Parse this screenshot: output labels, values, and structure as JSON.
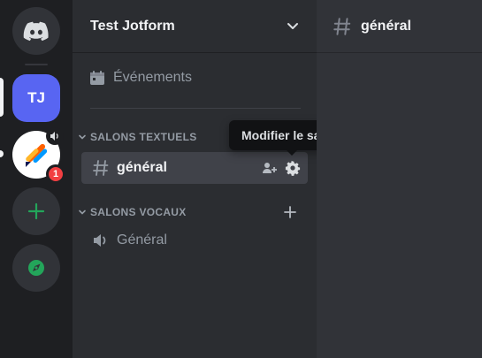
{
  "server": {
    "name": "Test Jotform",
    "initials": "TJ"
  },
  "rail": {
    "unread_badge": "1"
  },
  "sidebar": {
    "events_label": "Événements",
    "categories": [
      {
        "label": "SALONS TEXTUELS"
      },
      {
        "label": "SALONS VOCAUX"
      }
    ],
    "text_channel": "général",
    "voice_channel": "Général"
  },
  "tooltip": {
    "text": "Modifier le salon"
  },
  "main": {
    "channel_title": "général"
  },
  "colors": {
    "blurple": "#5865f2",
    "green": "#23a55a",
    "red": "#f23f42",
    "rail_bg": "#1e1f22",
    "sidebar_bg": "#2b2d31",
    "main_bg": "#313338"
  }
}
